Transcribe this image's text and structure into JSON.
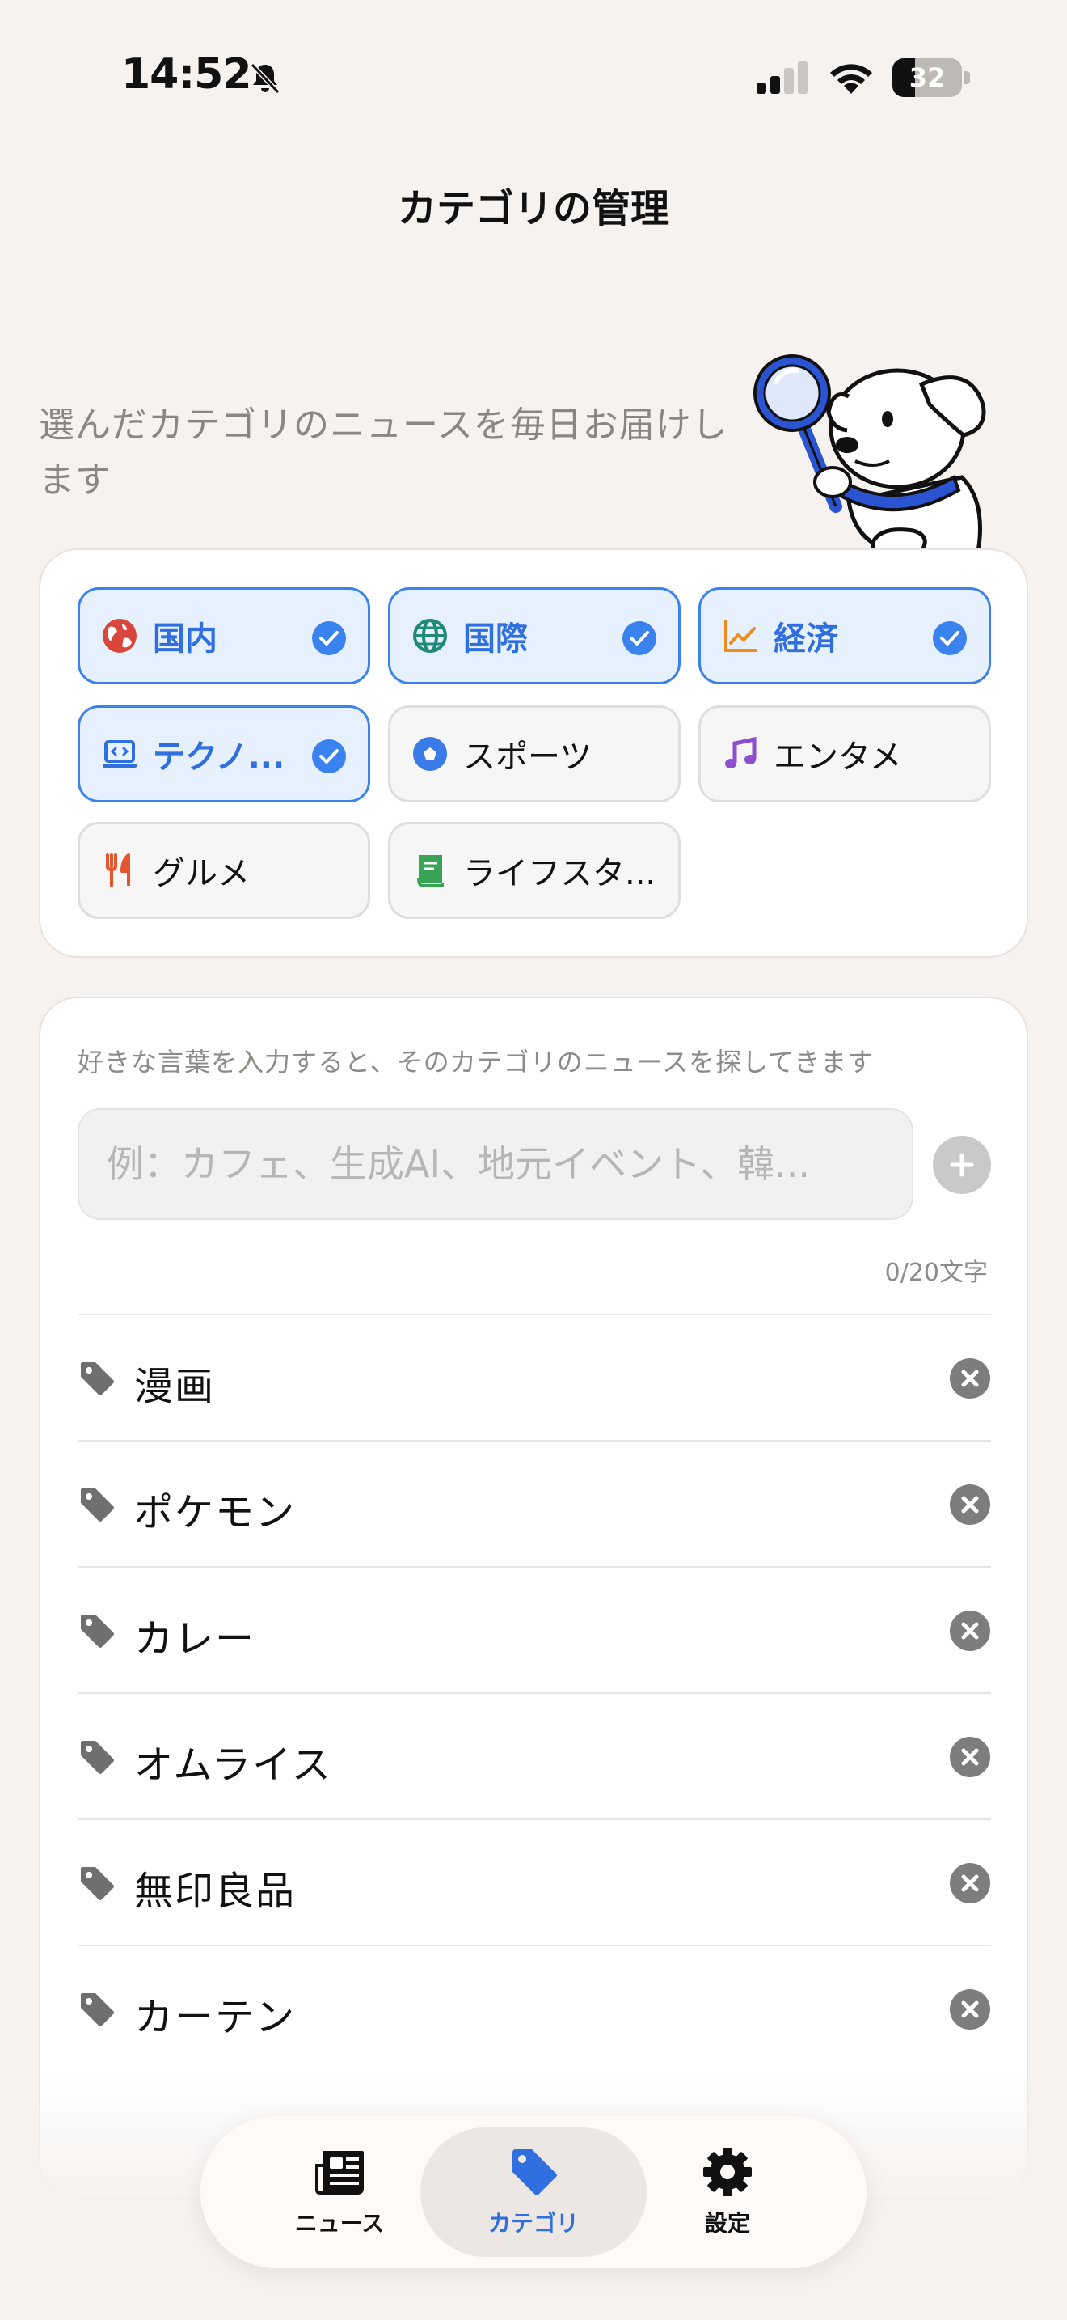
{
  "status_bar": {
    "time": "14:52",
    "battery": "32",
    "battery_level": 0.32
  },
  "header": {
    "title": "カテゴリの管理"
  },
  "intro": {
    "text": "選んだカテゴリのニュースを毎日お届けします"
  },
  "categories": [
    {
      "label": "国内",
      "icon": "globe-asia-icon",
      "selected": true,
      "color": "#d9473c"
    },
    {
      "label": "国際",
      "icon": "globe-icon",
      "selected": true,
      "color": "#1f8a7a"
    },
    {
      "label": "経済",
      "icon": "chart-line-icon",
      "selected": true,
      "color": "#f08c1e"
    },
    {
      "label": "テクノ...",
      "icon": "laptop-code-icon",
      "selected": true,
      "color": "#2f6fe0"
    },
    {
      "label": "スポーツ",
      "icon": "soccer-ball-icon",
      "selected": false,
      "color": "#3a7be8"
    },
    {
      "label": "エンタメ",
      "icon": "music-note-icon",
      "selected": false,
      "color": "#8b4fd0"
    },
    {
      "label": "グルメ",
      "icon": "utensils-icon",
      "selected": false,
      "color": "#e4572e"
    },
    {
      "label": "ライフスタ...",
      "icon": "book-icon",
      "selected": false,
      "color": "#3aa456"
    }
  ],
  "keywords_section": {
    "hint": "好きな言葉を入力すると、そのカテゴリのニュースを探してきます",
    "placeholder": "例：カフェ、生成AI、地元イベント、韓...",
    "value": "",
    "counter": "0/20文字",
    "items": [
      "漫画",
      "ポケモン",
      "カレー",
      "オムライス",
      "無印良品",
      "カーテン"
    ]
  },
  "tabbar": {
    "tabs": [
      {
        "label": "ニュース",
        "icon": "newspaper-icon",
        "active": false
      },
      {
        "label": "カテゴリ",
        "icon": "tag-icon",
        "active": true
      },
      {
        "label": "設定",
        "icon": "gear-icon",
        "active": false
      }
    ]
  },
  "colors": {
    "accent": "#2f6fe0",
    "background": "#f6f2ef",
    "selected_chip_bg": "#e7f0fd"
  }
}
